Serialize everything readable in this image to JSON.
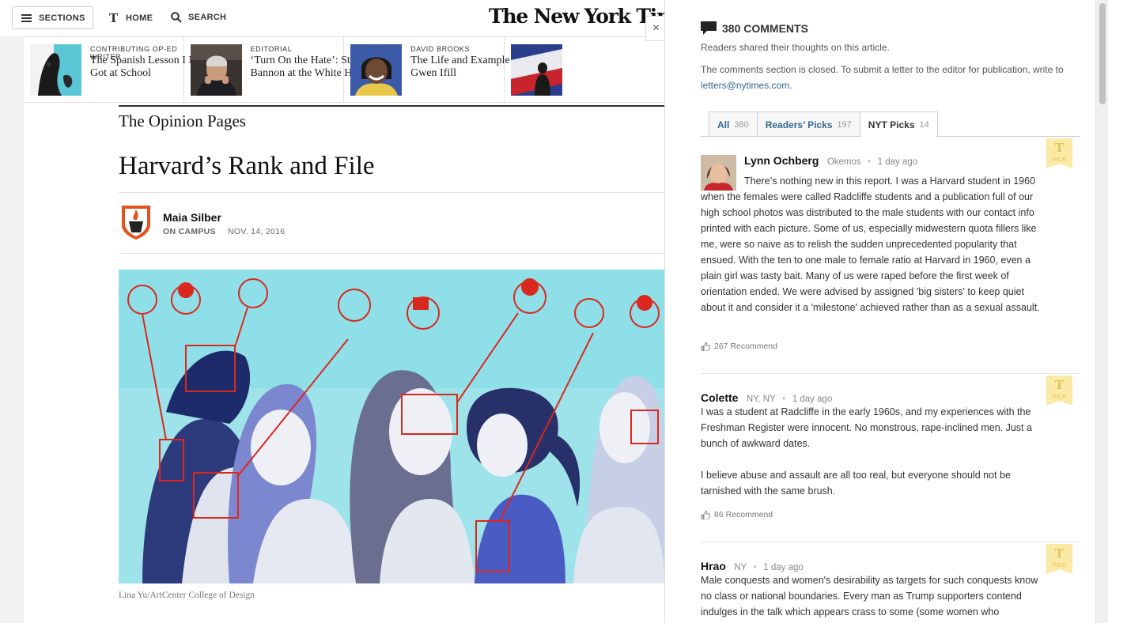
{
  "topbar": {
    "sections_label": "SECTIONS",
    "home_label": "HOME",
    "search_label": "SEARCH",
    "logo_text": "The New York Times"
  },
  "promos": [
    {
      "kicker": "CONTRIBUTING OP-ED WRITER",
      "headline": "The Spanish Lesson I Never Got at School"
    },
    {
      "kicker": "EDITORIAL",
      "headline": "‘Turn On the Hate’: Steve Bannon at the White House"
    },
    {
      "kicker": "DAVID BROOKS",
      "headline": "The Life and Example of Gwen Ifill"
    }
  ],
  "article": {
    "section": "The Opinion Pages",
    "title": "Harvard’s Rank and File",
    "author": "Maia Silber",
    "column": "ON CAMPUS",
    "date": "NOV. 14, 2016",
    "caption": "Lina Yu/ArtCenter College of Design"
  },
  "comments_panel": {
    "close_label": "×",
    "heading": "380 COMMENTS",
    "subtitle": "Readers shared their thoughts on this article.",
    "closed_notice": "The comments section is closed. To submit a letter to the editor for publication, write to ",
    "email": "letters@nytimes.com",
    "closed_end": ".",
    "tabs": [
      {
        "label": "All",
        "count": "380"
      },
      {
        "label": "Readers’ Picks",
        "count": "197"
      },
      {
        "label": "NYT Picks",
        "count": "14"
      }
    ],
    "comments": [
      {
        "name": "Lynn Ochberg",
        "location": "Okemos",
        "time": "1 day ago",
        "body": [
          "There’s nothing new in this report. I was a Harvard student in 1960 when the females were called Radcliffe students and a publication full of our high school photos was distributed to the male students with our contact info printed with each picture. Some of us, especially midwestern quota fillers like me, were so naive as to relish the sudden unprecedented popularity that ensued. With the ten to one male to female ratio at Harvard in 1960, even a plain girl was tasty bait. Many of us were raped before the first week of orientation ended. We were advised by assigned 'big sisters' to keep quiet about it and consider it a 'milestone' achieved rather than as a sexual assault."
        ],
        "recommend": "267 Recommend",
        "pick_label": "PICK"
      },
      {
        "name": "Colette",
        "location": "NY, NY",
        "time": "1 day ago",
        "body": [
          "I was a student at Radcliffe in the early 1960s, and my experiences with the Freshman Register were innocent. No monstrous, rape-inclined men. Just a bunch of awkward dates.",
          "I believe abuse and assault are all too real, but everyone should not be tarnished with the same brush."
        ],
        "recommend": "86 Recommend",
        "pick_label": "PICK"
      },
      {
        "name": "Hrao",
        "location": "NY",
        "time": "1 day ago",
        "body": [
          "Male conquests and women's desirability as targets for such conquests know no class or national boundaries. Every man as Trump supporters contend indulges in the talk which appears crass to some (some women who"
        ],
        "recommend": "",
        "pick_label": "PICK"
      }
    ]
  }
}
